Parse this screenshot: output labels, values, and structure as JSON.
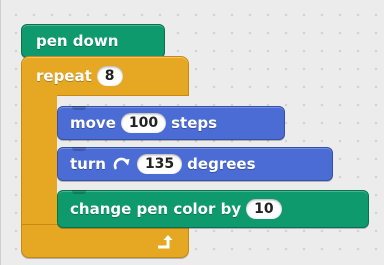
{
  "blocks": {
    "pen_down": {
      "label": "pen down"
    },
    "repeat": {
      "label": "repeat",
      "count": "8"
    },
    "move": {
      "label_before": "move",
      "steps": "100",
      "label_after": "steps"
    },
    "turn": {
      "label_before": "turn",
      "degrees": "135",
      "label_after": "degrees"
    },
    "change_pen_color": {
      "label_before": "change pen color by",
      "value": "10"
    }
  },
  "icons": {
    "turn_arrow": "rotate-clockwise-icon",
    "loop_arrow": "loop-arrow-icon"
  },
  "colors": {
    "pen": "#0e9a6c",
    "motion": "#4a6cd4",
    "control": "#e6a822",
    "background": "#ececec"
  }
}
